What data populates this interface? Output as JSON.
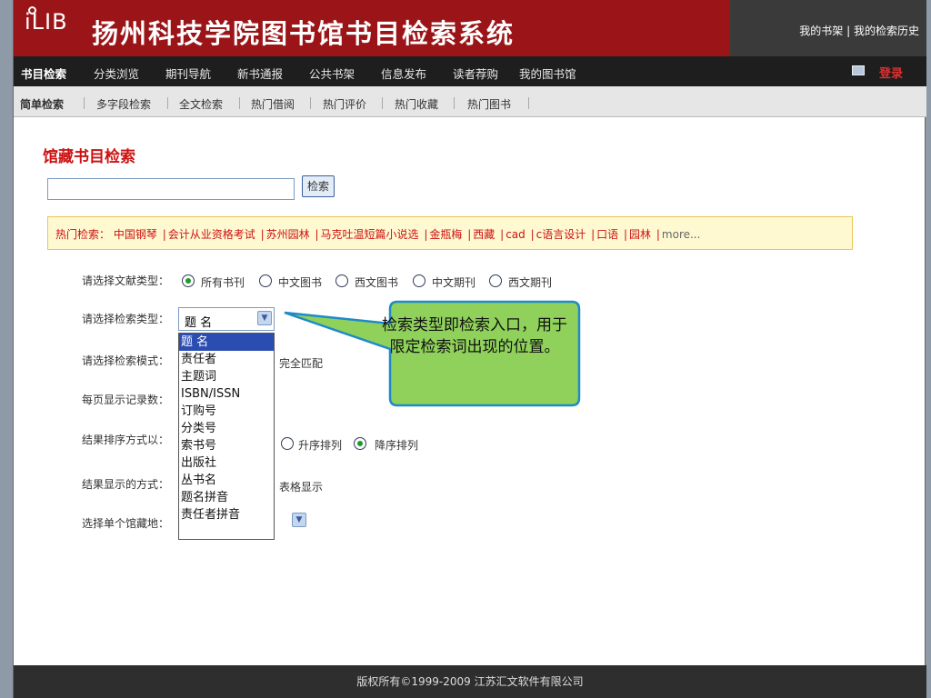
{
  "header": {
    "logo": "iLIB",
    "title": "扬州科技学院图书馆书目检索系统",
    "links": [
      "我的书架",
      "我的检索历史"
    ],
    "link_sep": "|"
  },
  "mainnav": {
    "items": [
      "书目检索",
      "分类浏览",
      "期刊导航",
      "新书通报",
      "公共书架",
      "信息发布",
      "读者荐购",
      "我的图书馆"
    ],
    "login": "登录"
  },
  "subnav": {
    "items": [
      "简单检索",
      "多字段检索",
      "全文检索",
      "热门借阅",
      "热门评价",
      "热门收藏",
      "热门图书"
    ]
  },
  "content": {
    "title": "馆藏书目检索",
    "search_value": "",
    "search_button": "检索",
    "hot": {
      "label": "热门检索：",
      "items": [
        "中国钢琴",
        "会计从业资格考试",
        "苏州园林",
        "马克吐温短篇小说选",
        "金瓶梅",
        "西藏",
        "cad",
        "c语言设计",
        "口语",
        "园林"
      ],
      "more": "more..."
    }
  },
  "form": {
    "doc_type_label": "请选择文献类型：",
    "doc_types": [
      "所有书刊",
      "中文图书",
      "西文图书",
      "中文期刊",
      "西文期刊"
    ],
    "search_type_label": "请选择检索类型：",
    "search_type_value": "题 名",
    "search_type_options": [
      "题 名",
      "责任者",
      "主题词",
      "ISBN/ISSN",
      "订购号",
      "分类号",
      "索书号",
      "出版社",
      "丛书名",
      "题名拼音",
      "责任者拼音"
    ],
    "mode_label": "请选择检索模式：",
    "mode_option": "完全匹配",
    "per_page_label": "每页显示记录数：",
    "sort_label": "结果排序方式以：",
    "sort_options": [
      "升序排列",
      "降序排列"
    ],
    "display_label": "结果显示的方式：",
    "display_option": "表格显示",
    "location_label": "选择单个馆藏地："
  },
  "callout": {
    "text": "检索类型即检索入口，用于限定检索词出现的位置。",
    "fill": "#8fd15a",
    "stroke": "#1f8ac8"
  },
  "footer": {
    "text": "版权所有©1999-2009 江苏汇文软件有限公司"
  },
  "colors": {
    "header_red": "#9b1518",
    "title_red": "#cc1111",
    "dropdown_selected": "#2b4db2"
  }
}
